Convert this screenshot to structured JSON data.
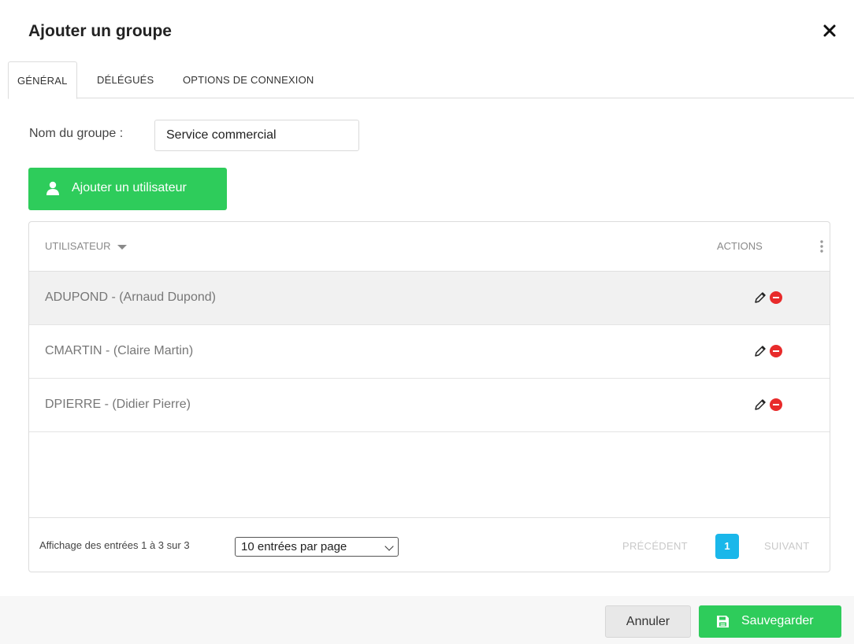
{
  "dialog": {
    "title": "Ajouter un groupe",
    "close_icon": "close-icon"
  },
  "tabs": [
    {
      "label": "GÉNÉRAL",
      "active": true
    },
    {
      "label": "DÉLÉGUÉS",
      "active": false
    },
    {
      "label": "OPTIONS DE CONNEXION",
      "active": false
    }
  ],
  "form": {
    "group_name_label": "Nom du groupe :",
    "group_name_value": "Service commercial"
  },
  "add_user_button": {
    "label": "Ajouter un utilisateur",
    "icon": "user-icon"
  },
  "table": {
    "columns": {
      "user": "UTILISATEUR",
      "actions": "ACTIONS"
    },
    "rows": [
      {
        "label": "ADUPOND - (Arnaud Dupond)"
      },
      {
        "label": "CMARTIN - (Claire Martin)"
      },
      {
        "label": "DPIERRE - (Didier Pierre)"
      }
    ],
    "footer": {
      "info": "Affichage des entrées 1 à 3 sur 3",
      "page_size": "10 entrées par page",
      "prev": "PRÉCÉDENT",
      "current_page": "1",
      "next": "SUIVANT"
    }
  },
  "buttons": {
    "cancel": "Annuler",
    "save": "Sauvegarder",
    "save_icon": "save-icon"
  },
  "colors": {
    "primary_green": "#2ecc5b",
    "page_blue": "#1ab7ea",
    "remove_red": "#e82b2b"
  }
}
